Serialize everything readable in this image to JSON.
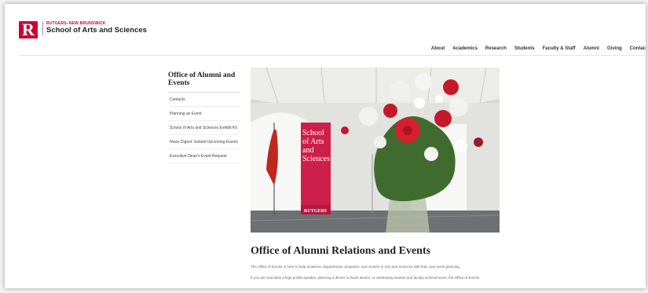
{
  "header": {
    "logo_letter": "R",
    "logo_sub": "RUTGERS–NEW BRUNSWICK",
    "logo_main": "School of Arts and Sciences"
  },
  "nav": {
    "items": [
      "About",
      "Academics",
      "Research",
      "Students",
      "Faculty & Staff",
      "Alumni",
      "Giving",
      "Contac"
    ]
  },
  "sidebar": {
    "title": "Office of Alumni and Events",
    "items": [
      "Contacts",
      "Planning an Event",
      "School of Arts and Sciences Exhibit Kit",
      "News Digest: Submit Upcoming Events",
      "Executive Dean's Event Request"
    ]
  },
  "hero": {
    "banner_text": "School of Arts and Sciences",
    "banner_footer": "RUTGERS"
  },
  "main": {
    "title": "Office of Alumni Relations and Events",
    "paragraph1": "The Office of Events is here to help academic departments, programs, and centers in Arts and Sciences with their own event planning.",
    "paragraph2": "If you are executive a high profile speaker, planning a dinner to thank alumni, or celebrating student and faculty achievements, the Office of Events"
  },
  "colors": {
    "brand": "#cc0033"
  }
}
